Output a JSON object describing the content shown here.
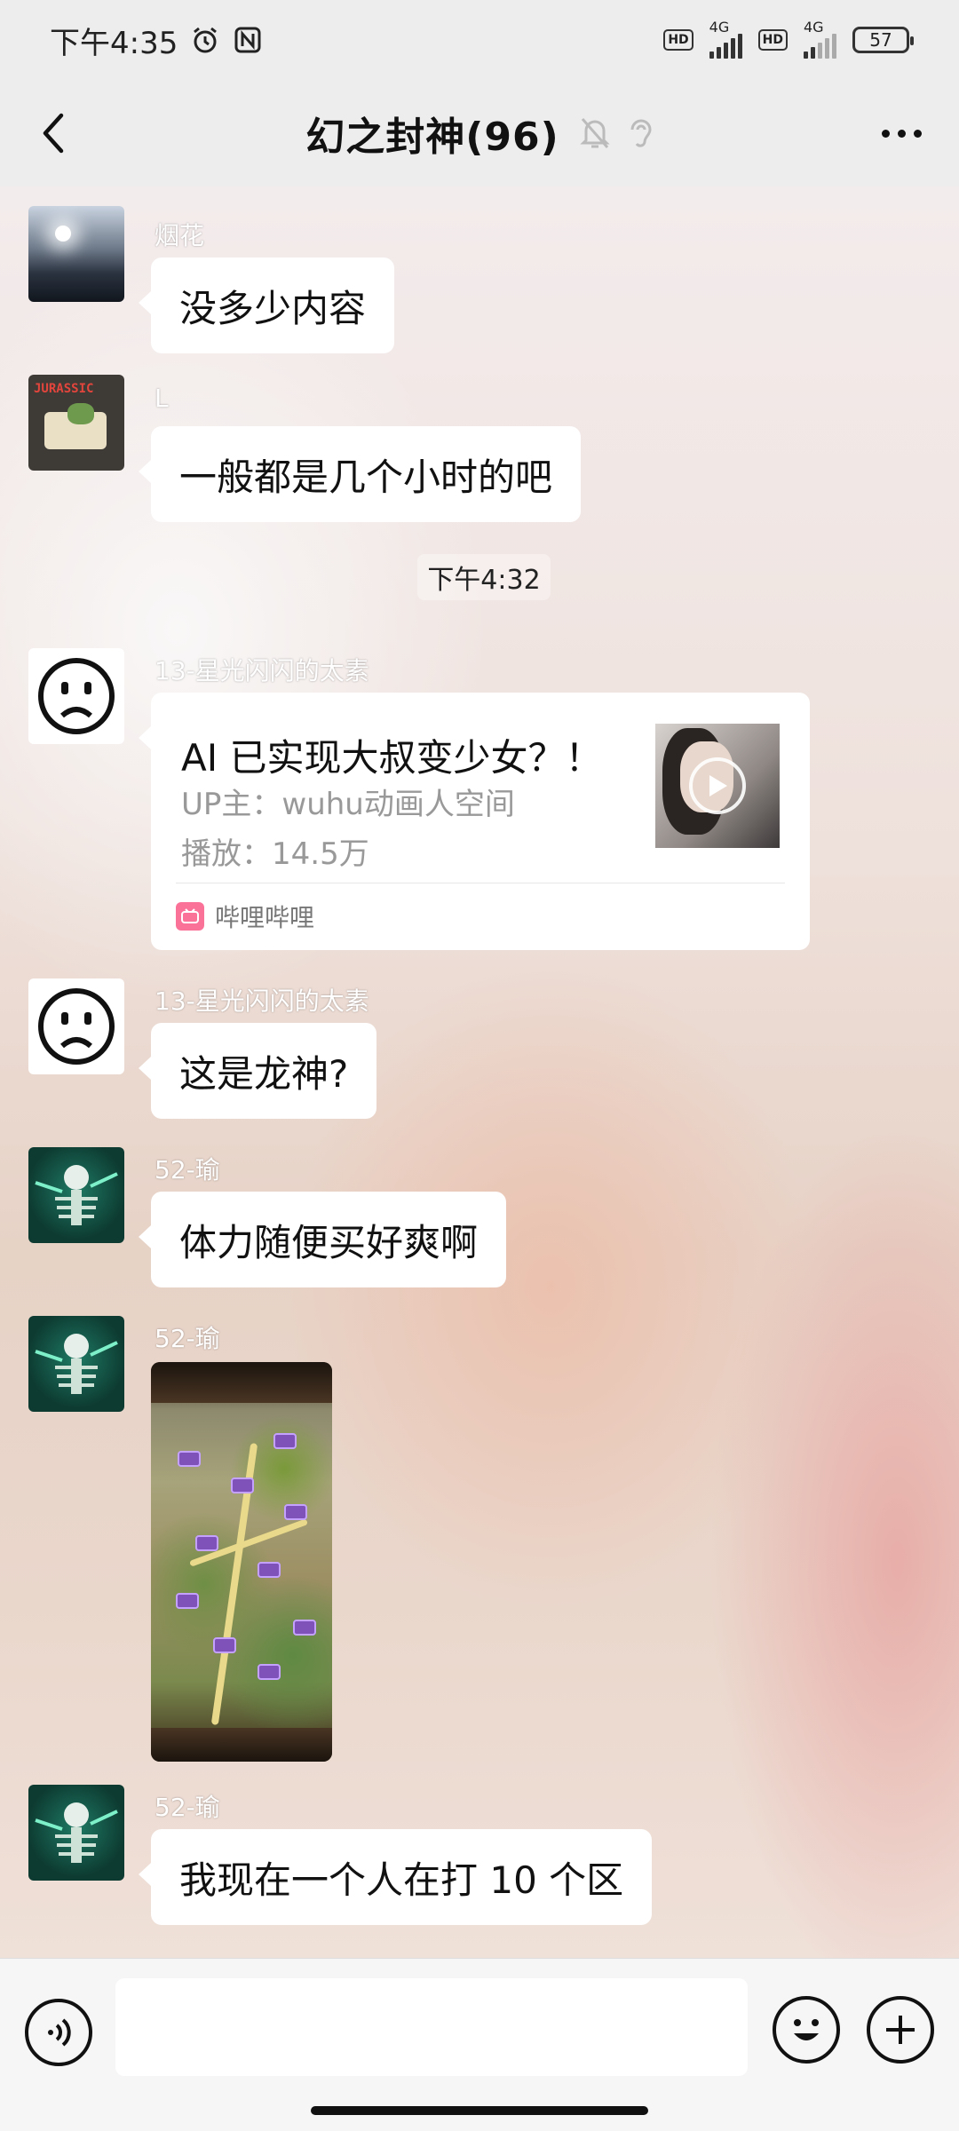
{
  "status_bar": {
    "time": "下午4:35",
    "alarm_icon": "alarm-icon",
    "nfc_icon": "nfc-icon",
    "hd1": "HD",
    "net1": "4G",
    "hd2": "HD",
    "net2": "4G",
    "battery": "57"
  },
  "header": {
    "title": "幻之封神(96)",
    "mute_icon": "bell-muted-icon",
    "ear_icon": "ear-icon",
    "more_icon": "more-icon",
    "back_icon": "back-icon"
  },
  "messages": [
    {
      "type": "text",
      "sender": "烟花",
      "text": "没多少内容"
    },
    {
      "type": "text",
      "sender": "L",
      "text": "一般都是几个小时的吧"
    },
    {
      "type": "time",
      "text": "下午4:32"
    },
    {
      "type": "card",
      "sender": "13-星光闪闪的太素",
      "title": "AI 已实现大叔变少女？！",
      "up": "UP主：wuhu动画人空间",
      "plays": "播放：14.5万",
      "source": "哔哩哔哩"
    },
    {
      "type": "text",
      "sender": "13-星光闪闪的太素",
      "text": "这是龙神?"
    },
    {
      "type": "text",
      "sender": "52-瑜",
      "text": "体力随便买好爽啊"
    },
    {
      "type": "image",
      "sender": "52-瑜"
    },
    {
      "type": "text",
      "sender": "52-瑜",
      "text": "我现在一个人在打 10 个区"
    }
  ],
  "input_bar": {
    "voice_icon": "voice-icon",
    "emoji_icon": "emoji-icon",
    "plus_icon": "plus-icon",
    "placeholder": ""
  }
}
